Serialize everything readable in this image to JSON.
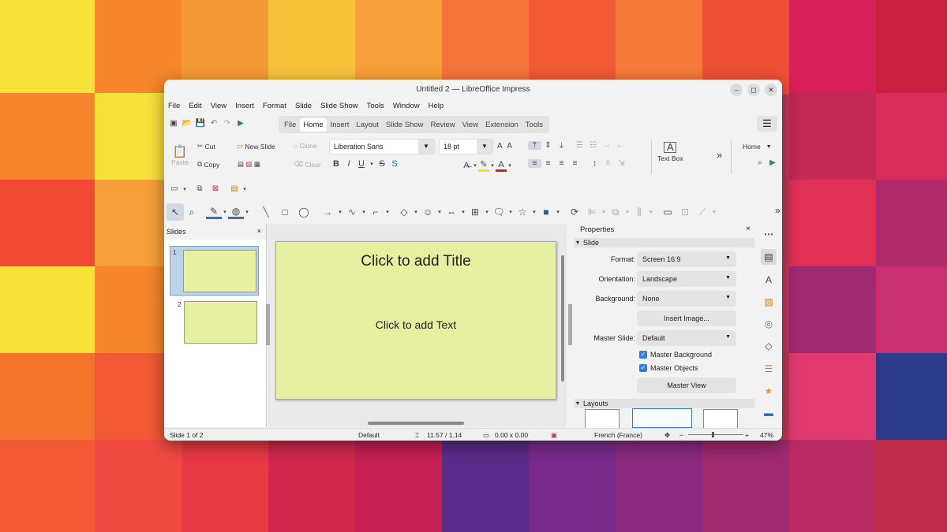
{
  "window": {
    "title": "Untitled 2 — LibreOffice Impress",
    "minimize": "–",
    "maximize": "◻",
    "close": "✕"
  },
  "menu": [
    "File",
    "Edit",
    "View",
    "Insert",
    "Format",
    "Slide",
    "Slide Show",
    "Tools",
    "Window",
    "Help"
  ],
  "tabs": [
    "File",
    "Home",
    "Insert",
    "Layout",
    "Slide Show",
    "Review",
    "View",
    "Extension",
    "Tools"
  ],
  "active_tab": "Home",
  "toolbar": {
    "paste": "Paste",
    "cut": "Cut",
    "copy": "Copy",
    "new_slide": "New Slide",
    "clone": "Clone",
    "clear": "Clear",
    "font_name": "Liberation Sans",
    "font_size": "18 pt",
    "text_box": "Text Box",
    "home_dropdown": "Home"
  },
  "slides_pane": {
    "title": "Slides",
    "close": "×",
    "thumbs": [
      "1",
      "2"
    ]
  },
  "slide": {
    "title_placeholder": "Click to add Title",
    "text_placeholder": "Click to add Text"
  },
  "properties": {
    "title": "Properties",
    "close": "×",
    "section_slide": "Slide",
    "format_label": "Format:",
    "format_value": "Screen 16:9",
    "orientation_label": "Orientation:",
    "orientation_value": "Landscape",
    "background_label": "Background:",
    "background_value": "None",
    "insert_image": "Insert Image...",
    "master_slide_label": "Master Slide:",
    "master_slide_value": "Default",
    "master_background": "Master Background",
    "master_objects": "Master Objects",
    "master_view": "Master View",
    "section_layouts": "Layouts"
  },
  "status": {
    "slide": "Slide 1 of 2",
    "master": "Default",
    "position": "11.57 / 1.14",
    "size": "0.00 x 0.00",
    "language": "French (France)",
    "zoom": "47%"
  },
  "colors": {
    "slide_bg": "#e6f0a0",
    "accent": "#3a7bd5"
  }
}
